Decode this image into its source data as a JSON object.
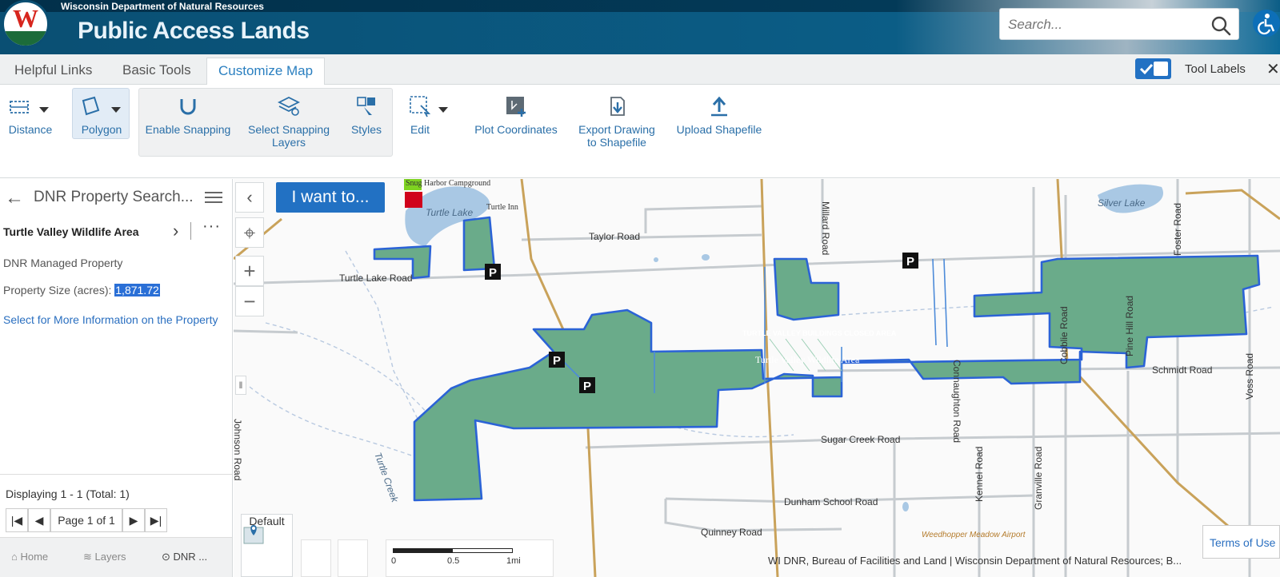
{
  "header": {
    "department": "Wisconsin Department of Natural Resources",
    "title": "Public Access Lands",
    "logo_letter": "W",
    "search_placeholder": "Search..."
  },
  "tabs": [
    {
      "label": "Helpful Links",
      "active": false
    },
    {
      "label": "Basic Tools",
      "active": false
    },
    {
      "label": "Customize Map",
      "active": true
    }
  ],
  "tool_labels": {
    "label": "Tool Labels",
    "checked": true
  },
  "toolbar": {
    "distance": "Distance",
    "polygon": "Polygon",
    "enable_snapping": "Enable Snapping",
    "select_snapping_layers": "Select Snapping Layers",
    "styles": "Styles",
    "edit": "Edit",
    "plot_coordinates": "Plot Coordinates",
    "export_drawing": "Export Drawing to Shapefile",
    "upload_shapefile": "Upload Shapefile"
  },
  "left_panel": {
    "title": "DNR Property Search...",
    "result": {
      "name": "Turtle Valley Wildlife Area",
      "type": "DNR Managed Property",
      "size_label": "Property Size (acres):",
      "size_value": "1,871.72",
      "link": "Select for More Information on the Property"
    },
    "displaying": "Displaying 1 - 1 (Total: 1)",
    "page": "Page 1 of 1",
    "bottom_tabs": [
      "Home",
      "Layers",
      "DNR ..."
    ]
  },
  "map": {
    "iwant": "I want to...",
    "default_label": "Default",
    "terms": "Terms of Use",
    "attribution": "WI DNR, Bureau of Facilities and Land | Wisconsin Department of Natural Resources; B...",
    "scale": {
      "left": "0",
      "mid": "0.5",
      "right": "1mi"
    },
    "roads": [
      "Taylor Road",
      "Turtle Lake Road",
      "Sugar Creek Road",
      "Dunham School Road",
      "Quinney Road",
      "Schmidt Road",
      "Johnson Road",
      "Millard Road",
      "Connaughton Road",
      "Cobblie Road",
      "Pine Hill Road",
      "Kennel Road",
      "Granville Road",
      "Foster Road",
      "Voss Road"
    ],
    "places": [
      "Turtle Lake",
      "Silver Lake",
      "Snug Harbor Campground",
      "Turtle Inn",
      "Turtle Creek",
      "Turtle Valley Wildlife Area",
      "TURTLE VALLEY BUILDINGS CLOSED AREA",
      "Weedhopper Meadow Airport"
    ],
    "colors": {
      "property_fill": "#6aab8a",
      "property_stroke": "#2b63d6",
      "road": "#c9a25a",
      "lake": "#a9c8e4"
    }
  }
}
